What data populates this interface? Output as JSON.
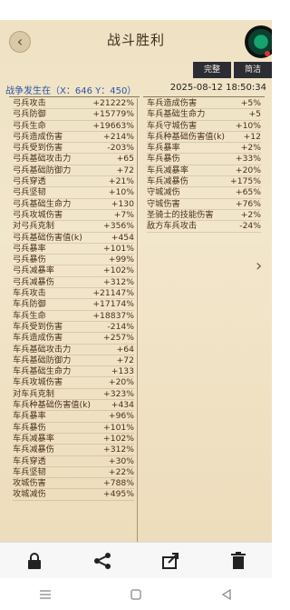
{
  "header": {
    "title": "战斗胜利",
    "tabs": [
      "完整",
      "简洁"
    ]
  },
  "info": {
    "location": "战争发生在（X：646 Y：450）",
    "datetime": "2025-08-12  18:50:34"
  },
  "left_rows": [
    {
      "label": "弓兵攻击",
      "value": "+21222%"
    },
    {
      "label": "弓兵防御",
      "value": "+15779%"
    },
    {
      "label": "弓兵生命",
      "value": "+19663%"
    },
    {
      "label": "弓兵造成伤害",
      "value": "+214%"
    },
    {
      "label": "弓兵受到伤害",
      "value": "-203%"
    },
    {
      "label": "弓兵基础攻击力",
      "value": "+65"
    },
    {
      "label": "弓兵基础防御力",
      "value": "+72"
    },
    {
      "label": "弓兵穿透",
      "value": "+21%"
    },
    {
      "label": "弓兵坚韧",
      "value": "+10%"
    },
    {
      "label": "弓兵基础生命力",
      "value": "+130"
    },
    {
      "label": "弓兵攻城伤害",
      "value": "+7%"
    },
    {
      "label": "对弓兵克制",
      "value": "+356%"
    },
    {
      "label": "弓兵基础伤害值(k)",
      "value": "+454"
    },
    {
      "label": "弓兵暴率",
      "value": "+101%"
    },
    {
      "label": "弓兵暴伤",
      "value": "+99%"
    },
    {
      "label": "弓兵减暴率",
      "value": "+102%"
    },
    {
      "label": "弓兵减暴伤",
      "value": "+312%"
    },
    {
      "label": "车兵攻击",
      "value": "+21147%"
    },
    {
      "label": "车兵防御",
      "value": "+17174%"
    },
    {
      "label": "车兵生命",
      "value": "+18837%"
    },
    {
      "label": "车兵受到伤害",
      "value": "-214%"
    },
    {
      "label": "车兵造成伤害",
      "value": "+257%"
    },
    {
      "label": "车兵基础攻击力",
      "value": "+64"
    },
    {
      "label": "车兵基础防御力",
      "value": "+72"
    },
    {
      "label": "车兵基础生命力",
      "value": "+133"
    },
    {
      "label": "车兵攻城伤害",
      "value": "+20%"
    },
    {
      "label": "对车兵克制",
      "value": "+323%"
    },
    {
      "label": "车兵种基础伤害值(k)",
      "value": "+434"
    },
    {
      "label": "车兵暴率",
      "value": "+96%"
    },
    {
      "label": "车兵暴伤",
      "value": "+101%"
    },
    {
      "label": "车兵减暴率",
      "value": "+102%"
    },
    {
      "label": "车兵减暴伤",
      "value": "+312%"
    },
    {
      "label": "车兵穿透",
      "value": "+30%"
    },
    {
      "label": "车兵坚韧",
      "value": "+22%"
    },
    {
      "label": "攻城伤害",
      "value": "+788%"
    },
    {
      "label": "攻城减伤",
      "value": "+495%"
    }
  ],
  "right_rows": [
    {
      "label": "车兵造成伤害",
      "value": "+5%"
    },
    {
      "label": "车兵基础生命力",
      "value": "+5"
    },
    {
      "label": "车兵守城伤害",
      "value": "+10%"
    },
    {
      "label": "车兵种基础伤害值(k)",
      "value": "+12"
    },
    {
      "label": "车兵暴率",
      "value": "+2%"
    },
    {
      "label": "车兵暴伤",
      "value": "+33%"
    },
    {
      "label": "车兵减暴率",
      "value": "+20%"
    },
    {
      "label": "车兵减暴伤",
      "value": "+175%"
    },
    {
      "label": "守城减伤",
      "value": "+65%"
    },
    {
      "label": "守城伤害",
      "value": "+76%"
    },
    {
      "label": "圣骑士的技能伤害",
      "value": "+2%"
    },
    {
      "label": "敌方车兵攻击",
      "value": "-24%"
    }
  ],
  "colors": {
    "accent_blue": "#2f56a5",
    "text_brown": "#4a2f1a",
    "panel_bg": "#f0e3c6"
  },
  "icons": [
    "back-arrow-icon",
    "avatar-icon",
    "next-arrow-icon",
    "lock-icon",
    "share-icon",
    "forward-icon",
    "trash-icon",
    "menu-icon",
    "home-icon",
    "back-icon"
  ]
}
